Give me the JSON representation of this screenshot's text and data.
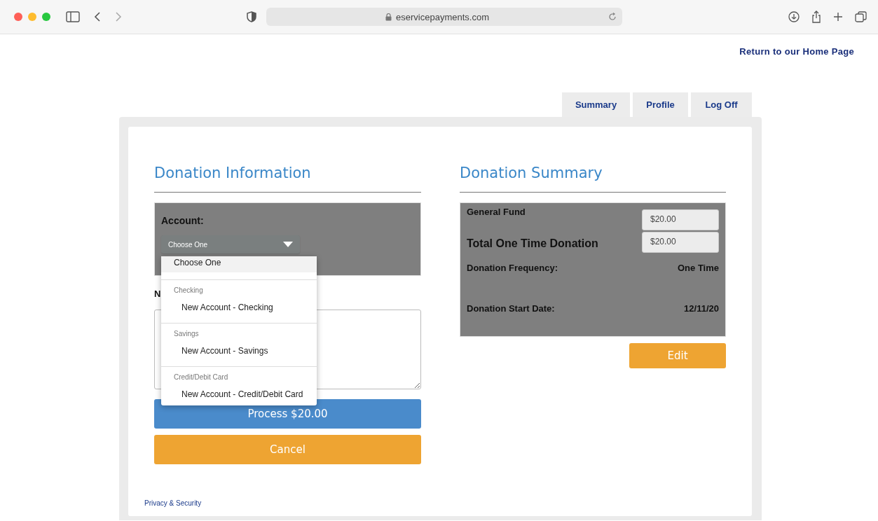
{
  "browser": {
    "url": "eservicepayments.com"
  },
  "header_link": "Return to our Home Page",
  "tabs": [
    {
      "label": "Summary",
      "selected": false
    },
    {
      "label": "Profile",
      "selected": false
    },
    {
      "label": "Log Off",
      "selected": false
    }
  ],
  "donation_information": {
    "title": "Donation Information",
    "account_label": "Account:",
    "account_select": {
      "value": "Choose One",
      "expanded": true
    },
    "dropdown": [
      {
        "kind": "option",
        "label": "Choose One",
        "selected": true
      },
      {
        "kind": "group",
        "label": "Checking"
      },
      {
        "kind": "option",
        "label": "New Account - Checking",
        "selected": false
      },
      {
        "kind": "group",
        "label": "Savings"
      },
      {
        "kind": "option",
        "label": "New Account - Savings",
        "selected": false
      },
      {
        "kind": "group",
        "label": "Credit/Debit Card"
      },
      {
        "kind": "option",
        "label": "New Account - Credit/Debit Card",
        "selected": false
      }
    ],
    "note_label": "N",
    "process_button": "Process $20.00",
    "cancel_button": "Cancel"
  },
  "donation_summary": {
    "title": "Donation Summary",
    "rows": [
      {
        "kind": "amount",
        "label": "General Fund",
        "value": "$20.00"
      },
      {
        "kind": "total",
        "label": "Total One Time Donation",
        "value": "$20.00"
      },
      {
        "kind": "info",
        "label": "Donation Frequency:",
        "value": "One Time"
      },
      {
        "kind": "info",
        "label": "Donation Start Date:",
        "value": "12/11/20"
      }
    ],
    "edit_button": "Edit"
  },
  "footer_link": "Privacy & Security"
}
